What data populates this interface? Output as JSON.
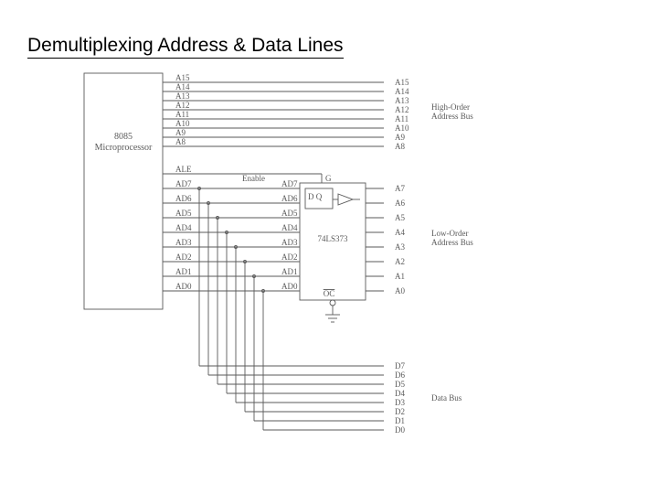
{
  "title": "Demultiplexing Address & Data Lines",
  "mpu": {
    "name": "8085",
    "sub": "Microprocessor"
  },
  "latch": {
    "name": "74LS373",
    "dq": "D   Q",
    "g_pin": "G",
    "oc_pin": "OC",
    "enable": "Enable"
  },
  "high_addr": {
    "label1": "High-Order",
    "label2": "Address Bus",
    "pins_left": [
      "A15",
      "A14",
      "A13",
      "A12",
      "A11",
      "A10",
      "A9",
      "A8"
    ],
    "pins_right": [
      "A15",
      "A14",
      "A13",
      "A12",
      "A11",
      "A10",
      "A9",
      "A8"
    ]
  },
  "ale": {
    "label": "ALE"
  },
  "ad": {
    "pins_left": [
      "AD7",
      "AD6",
      "AD5",
      "AD4",
      "AD3",
      "AD2",
      "AD1",
      "AD0"
    ],
    "latch_in": [
      "AD7",
      "AD6",
      "AD5",
      "AD4",
      "AD3",
      "AD2",
      "AD1",
      "AD0"
    ],
    "addr_out": [
      "A7",
      "A6",
      "A5",
      "A4",
      "A3",
      "A2",
      "A1",
      "A0"
    ],
    "data_out": [
      "D7",
      "D6",
      "D5",
      "D4",
      "D3",
      "D2",
      "D1",
      "D0"
    ]
  },
  "low_addr": {
    "label1": "Low-Order",
    "label2": "Address Bus"
  },
  "data_bus": {
    "label": "Data Bus"
  }
}
